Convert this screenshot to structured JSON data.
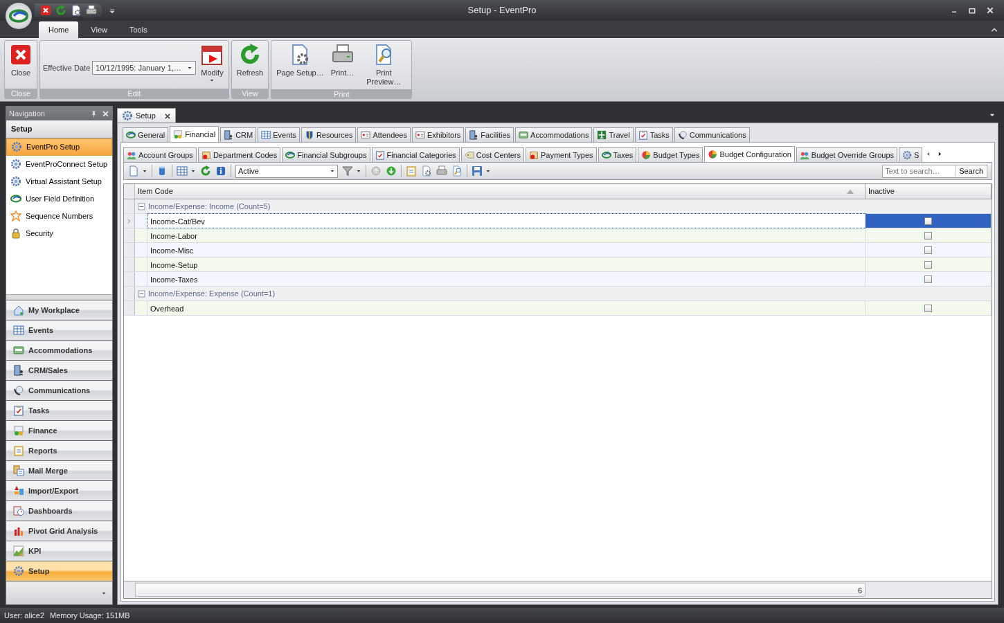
{
  "window": {
    "title": "Setup - EventPro"
  },
  "ribbon": {
    "tabs": [
      {
        "label": "Home",
        "selected": true
      },
      {
        "label": "View",
        "selected": false
      },
      {
        "label": "Tools",
        "selected": false
      }
    ],
    "groups": [
      {
        "caption": "Close",
        "items": [
          {
            "kind": "button",
            "label": "Close"
          }
        ]
      },
      {
        "caption": "Edit",
        "items": [
          {
            "kind": "date-field",
            "label": "Effective Date",
            "value": "10/12/1995: January 1,…"
          },
          {
            "kind": "menu-button",
            "label": "Modify"
          }
        ]
      },
      {
        "caption": "View",
        "items": [
          {
            "kind": "button",
            "label": "Refresh"
          }
        ]
      },
      {
        "caption": "Print",
        "items": [
          {
            "kind": "button",
            "label": "Page Setup…"
          },
          {
            "kind": "button",
            "label": "Print…"
          },
          {
            "kind": "button",
            "label": "Print Preview…"
          }
        ]
      }
    ]
  },
  "navigation": {
    "title": "Navigation",
    "section": "Setup",
    "items": [
      {
        "label": "EventPro Setup",
        "selected": true
      },
      {
        "label": "EventProConnect Setup",
        "selected": false
      },
      {
        "label": "Virtual Assistant Setup",
        "selected": false
      },
      {
        "label": "User Field Definition",
        "selected": false
      },
      {
        "label": "Sequence Numbers",
        "selected": false
      },
      {
        "label": "Security",
        "selected": false
      }
    ],
    "modules": [
      {
        "label": "My Workplace",
        "selected": false
      },
      {
        "label": "Events",
        "selected": false
      },
      {
        "label": "Accommodations",
        "selected": false
      },
      {
        "label": "CRM/Sales",
        "selected": false
      },
      {
        "label": "Communications",
        "selected": false
      },
      {
        "label": "Tasks",
        "selected": false
      },
      {
        "label": "Finance",
        "selected": false
      },
      {
        "label": "Reports",
        "selected": false
      },
      {
        "label": "Mail Merge",
        "selected": false
      },
      {
        "label": "Import/Export",
        "selected": false
      },
      {
        "label": "Dashboards",
        "selected": false
      },
      {
        "label": "Pivot Grid Analysis",
        "selected": false
      },
      {
        "label": "KPI",
        "selected": false
      },
      {
        "label": "Setup",
        "selected": true
      }
    ]
  },
  "document_tab": {
    "label": "Setup"
  },
  "module_tabs": [
    {
      "label": "General",
      "selected": false
    },
    {
      "label": "Financial",
      "selected": true
    },
    {
      "label": "CRM",
      "selected": false
    },
    {
      "label": "Events",
      "selected": false
    },
    {
      "label": "Resources",
      "selected": false
    },
    {
      "label": "Attendees",
      "selected": false
    },
    {
      "label": "Exhibitors",
      "selected": false
    },
    {
      "label": "Facilities",
      "selected": false
    },
    {
      "label": "Accommodations",
      "selected": false
    },
    {
      "label": "Travel",
      "selected": false
    },
    {
      "label": "Tasks",
      "selected": false
    },
    {
      "label": "Communications",
      "selected": false
    }
  ],
  "sub_tabs": [
    {
      "label": "Account Groups",
      "selected": false
    },
    {
      "label": "Department Codes",
      "selected": false
    },
    {
      "label": "Financial Subgroups",
      "selected": false
    },
    {
      "label": "Financial Categories",
      "selected": false
    },
    {
      "label": "Cost Centers",
      "selected": false
    },
    {
      "label": "Payment Types",
      "selected": false
    },
    {
      "label": "Taxes",
      "selected": false
    },
    {
      "label": "Budget Types",
      "selected": false
    },
    {
      "label": "Budget Configuration",
      "selected": true
    },
    {
      "label": "Budget Override Groups",
      "selected": false
    },
    {
      "label": "S",
      "selected": false
    }
  ],
  "toolbar": {
    "filter": {
      "value": "Active"
    },
    "search": {
      "placeholder": "Text to search…",
      "button": "Search"
    }
  },
  "grid": {
    "columns": [
      "Item Code",
      "Inactive"
    ],
    "groups": [
      {
        "label": "Income/Expense: Income (Count=5)",
        "expanded": true,
        "rows": [
          {
            "item_code": "Income-Cat/Bev",
            "inactive": false,
            "selected": true
          },
          {
            "item_code": "Income-Labor",
            "inactive": false,
            "selected": false
          },
          {
            "item_code": "Income-Misc",
            "inactive": false,
            "selected": false
          },
          {
            "item_code": "Income-Setup",
            "inactive": false,
            "selected": false
          },
          {
            "item_code": "Income-Taxes",
            "inactive": false,
            "selected": false
          }
        ]
      },
      {
        "label": "Income/Expense: Expense (Count=1)",
        "expanded": true,
        "rows": [
          {
            "item_code": "Overhead",
            "inactive": false,
            "selected": false
          }
        ]
      }
    ],
    "footer": "6"
  },
  "status_bar": {
    "user": "User: alice2",
    "memory": "Memory Usage: 151MB"
  }
}
